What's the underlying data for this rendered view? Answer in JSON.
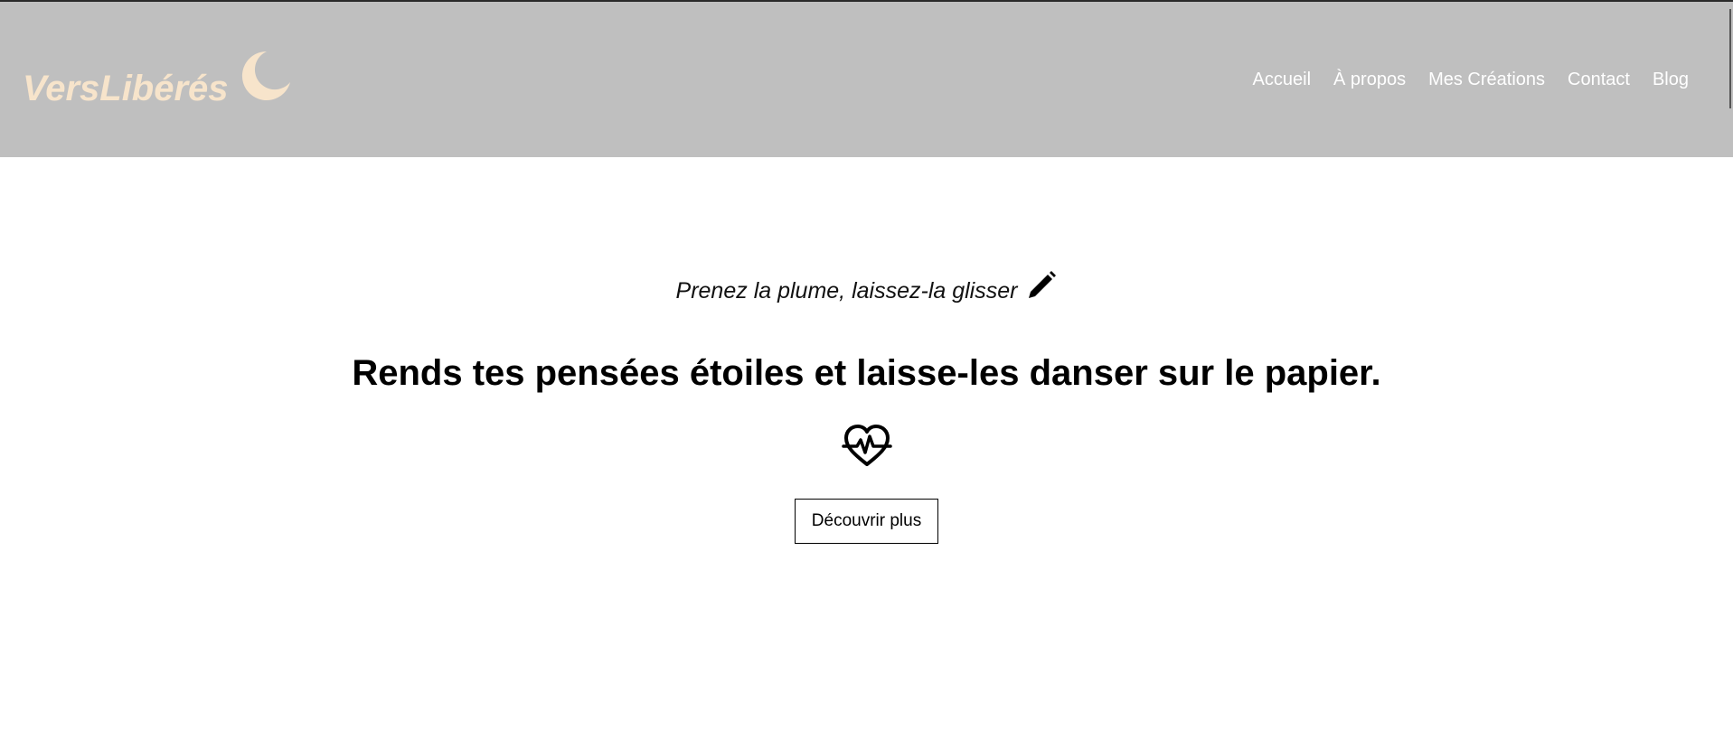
{
  "brand": {
    "name": "VersLibérés",
    "icon": "moon-icon",
    "color": "#f7e4cb"
  },
  "nav": {
    "items": [
      {
        "label": "Accueil"
      },
      {
        "label": "À propos"
      },
      {
        "label": "Mes Créations"
      },
      {
        "label": "Contact"
      },
      {
        "label": "Blog"
      }
    ]
  },
  "hero": {
    "tagline": "Prenez la plume, laissez-la glisser",
    "tagline_icon": "pencil-icon",
    "headline": "Rends tes pensées étoiles et laisse-les danser sur le papier.",
    "heart_icon": "heartbeat-icon",
    "cta_label": "Découvrir plus"
  },
  "colors": {
    "header_bg": "#bfbfbf",
    "nav_text": "#ffffff",
    "page_bg": "#ffffff"
  }
}
